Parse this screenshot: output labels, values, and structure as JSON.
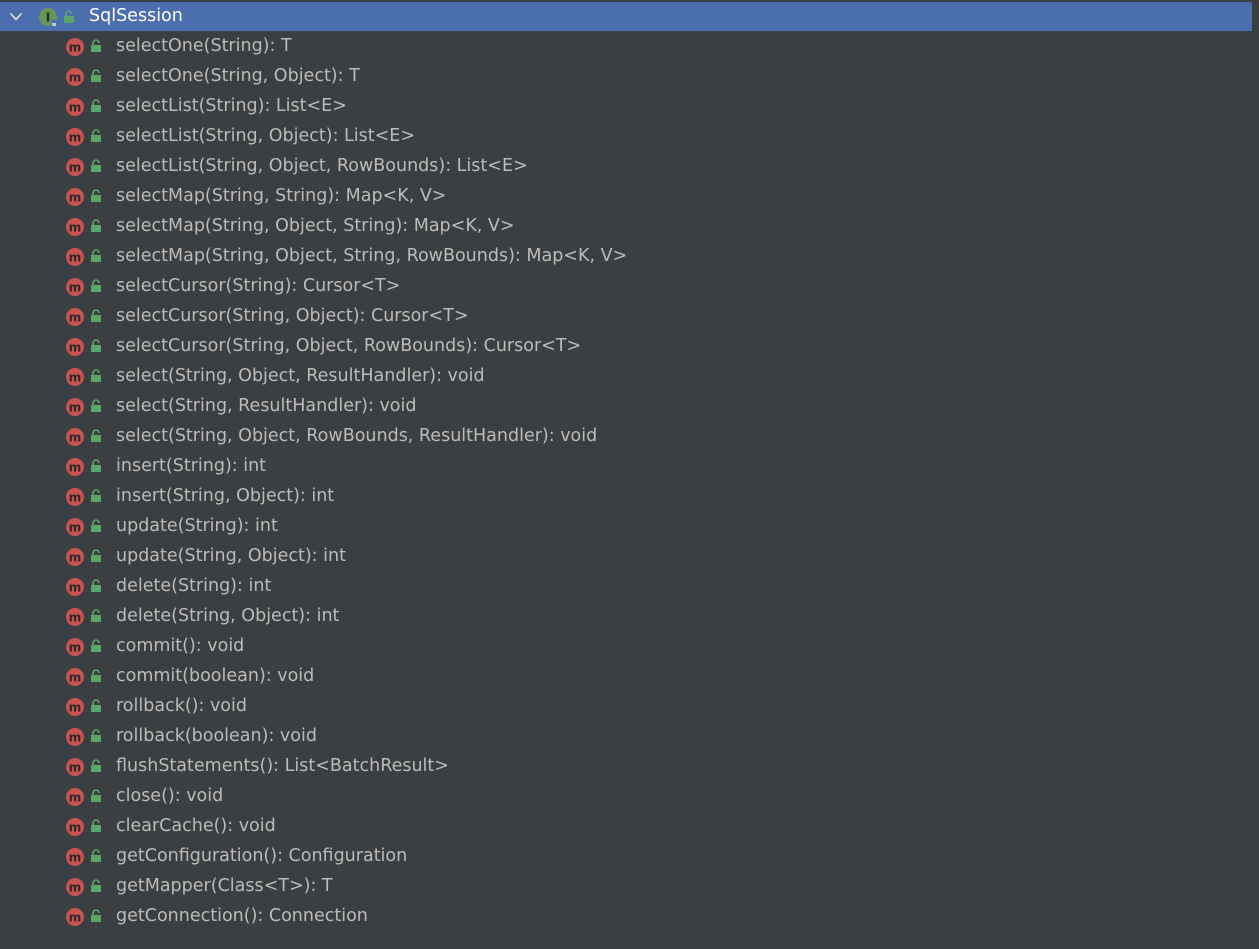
{
  "root": {
    "label": "SqlSession",
    "icon": "interface-icon",
    "expanded": true
  },
  "methods": [
    "selectOne(String): T",
    "selectOne(String, Object): T",
    "selectList(String): List<E>",
    "selectList(String, Object): List<E>",
    "selectList(String, Object, RowBounds): List<E>",
    "selectMap(String, String): Map<K, V>",
    "selectMap(String, Object, String): Map<K, V>",
    "selectMap(String, Object, String, RowBounds): Map<K, V>",
    "selectCursor(String): Cursor<T>",
    "selectCursor(String, Object): Cursor<T>",
    "selectCursor(String, Object, RowBounds): Cursor<T>",
    "select(String, Object, ResultHandler): void",
    "select(String, ResultHandler): void",
    "select(String, Object, RowBounds, ResultHandler): void",
    "insert(String): int",
    "insert(String, Object): int",
    "update(String): int",
    "update(String, Object): int",
    "delete(String): int",
    "delete(String, Object): int",
    "commit(): void",
    "commit(boolean): void",
    "rollback(): void",
    "rollback(boolean): void",
    "flushStatements(): List<BatchResult>",
    "close(): void",
    "clearCache(): void",
    "getConfiguration(): Configuration",
    "getMapper(Class<T>): T",
    "getConnection(): Connection"
  ],
  "colors": {
    "background": "#3c3f41",
    "selection": "#4b6eaf",
    "text": "#bbbbbb",
    "method_icon": "#c75450",
    "interface_icon": "#629755",
    "lock": "#59a869"
  }
}
